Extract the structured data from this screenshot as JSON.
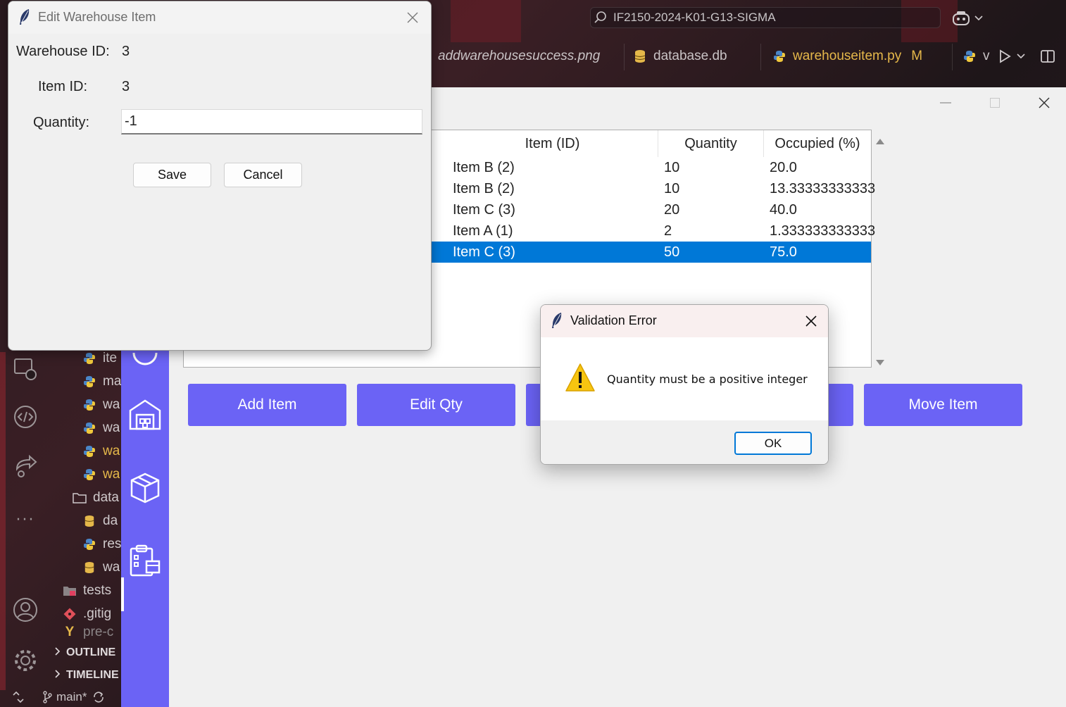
{
  "vscode": {
    "search_text": "IF2150-2024-K01-G13-SIGMA",
    "tabs": [
      {
        "label": "addwarehousesuccess.png"
      },
      {
        "label": "database.db"
      },
      {
        "label": "warehouseitem.py",
        "modified": "M"
      }
    ],
    "tab_overflow_label": "v",
    "explorer": {
      "items": [
        {
          "label": "ite",
          "icon": "python-icon"
        },
        {
          "label": "ma",
          "icon": "python-icon"
        },
        {
          "label": "wa",
          "icon": "python-icon"
        },
        {
          "label": "wa",
          "icon": "python-icon"
        },
        {
          "label": "wa",
          "icon": "python-icon",
          "modified": true
        },
        {
          "label": "wa",
          "icon": "python-icon",
          "modified": true
        },
        {
          "label": "data",
          "icon": "folder-icon"
        },
        {
          "label": "da",
          "icon": "database-icon"
        },
        {
          "label": "res",
          "icon": "python-icon"
        },
        {
          "label": "wa",
          "icon": "database-icon"
        },
        {
          "label": "tests",
          "icon": "folder-tests-icon"
        },
        {
          "label": ".gitig",
          "icon": "git-icon"
        },
        {
          "label": "pre-c",
          "icon": "yaml-icon"
        }
      ],
      "sections": [
        "OUTLINE",
        "TIMELINE"
      ]
    },
    "status": {
      "branch": "main*"
    }
  },
  "app": {
    "table": {
      "columns": [
        "Item (ID)",
        "Quantity",
        "Occupied (%)"
      ],
      "rows": [
        {
          "item": "Item B (2)",
          "quantity": "10",
          "occupied": "20.0"
        },
        {
          "item": "Item B (2)",
          "quantity": "10",
          "occupied": "13.33333333333"
        },
        {
          "item": "Item C (3)",
          "quantity": "20",
          "occupied": "40.0"
        },
        {
          "item": "Item A (1)",
          "quantity": "2",
          "occupied": "1.333333333333"
        },
        {
          "item": "Item C (3)",
          "quantity": "50",
          "occupied": "75.0",
          "selected": true
        }
      ]
    },
    "buttons": {
      "add_item": "Add Item",
      "edit_qty": "Edit Qty",
      "move_item": "Move Item"
    },
    "accent_color": "#6b63f5",
    "selection_color": "#0078d7"
  },
  "edit_dialog": {
    "title": "Edit Warehouse Item",
    "warehouse_id_label": "Warehouse ID:",
    "warehouse_id_value": "3",
    "item_id_label": "Item ID:",
    "item_id_value": "3",
    "quantity_label": "Quantity:",
    "quantity_value": "-1",
    "save_label": "Save",
    "cancel_label": "Cancel"
  },
  "error_dialog": {
    "title": "Validation Error",
    "message": "Quantity must be a positive integer",
    "ok_label": "OK"
  }
}
